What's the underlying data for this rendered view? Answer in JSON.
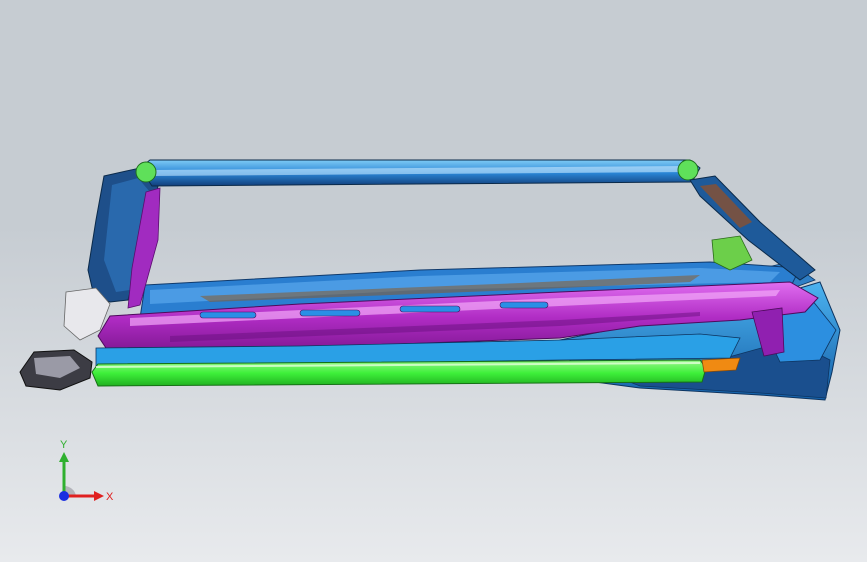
{
  "viewport": {
    "background_top": "#c6ccd2",
    "background_bottom": "#e8eaed"
  },
  "model": {
    "parts": [
      {
        "name": "roof-rail",
        "color": "#1e7fd6"
      },
      {
        "name": "a-pillar",
        "color": "#1e4f8a"
      },
      {
        "name": "b-pillar-reinforcement",
        "color": "#a12bc0"
      },
      {
        "name": "side-sill-inner",
        "color": "#c43ad6"
      },
      {
        "name": "sill-extension",
        "color": "#2aa0e6"
      },
      {
        "name": "rocker-tube",
        "color": "#3ef03a"
      },
      {
        "name": "rear-quarter",
        "color": "#1b6fb8"
      },
      {
        "name": "bracket",
        "color": "#f08a12"
      }
    ]
  },
  "triad": {
    "x_label": "X",
    "y_label": "Y",
    "x_color": "#e02020",
    "y_color": "#2fb02f",
    "z_color": "#1a2ee0"
  }
}
